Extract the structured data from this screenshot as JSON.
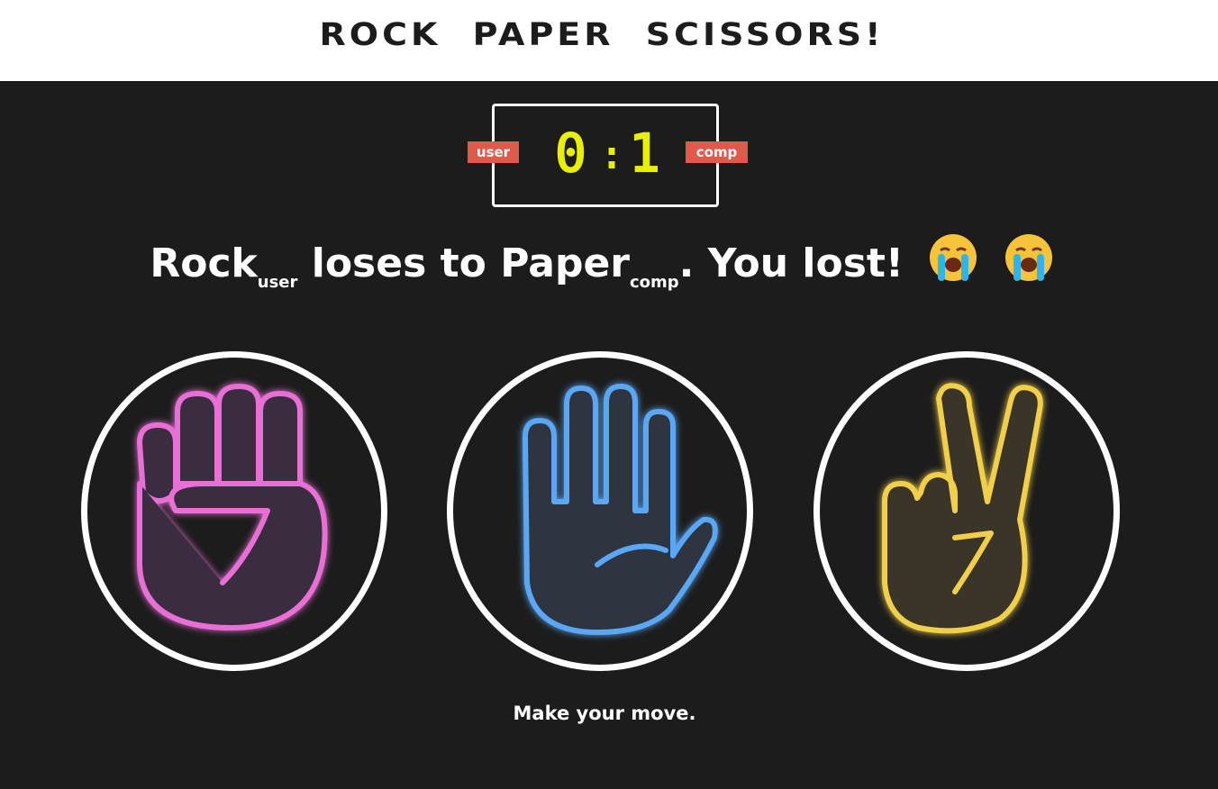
{
  "header": {
    "title": "ROCK PAPER SCISSORS!"
  },
  "scoreboard": {
    "user_label": "user",
    "comp_label": "comp",
    "user_score": "0",
    "separator": ":",
    "comp_score": "1",
    "digit_color": "#e8f000",
    "badge_color": "#e05a4b"
  },
  "result": {
    "user_choice": "Rock",
    "user_sub": "user",
    "verb": "loses to",
    "comp_choice": "Paper",
    "comp_sub": "comp",
    "message": ". You lost!",
    "emoji_icons": [
      "loudly-crying-face-icon",
      "loudly-crying-face-icon"
    ]
  },
  "choices": [
    {
      "name": "rock",
      "icon": "raised-fist-icon",
      "color": "#e86fd6"
    },
    {
      "name": "paper",
      "icon": "raised-hand-icon",
      "color": "#5aa8f5"
    },
    {
      "name": "scissors",
      "icon": "victory-hand-icon",
      "color": "#f2cf4a"
    }
  ],
  "prompt": "Make your move."
}
